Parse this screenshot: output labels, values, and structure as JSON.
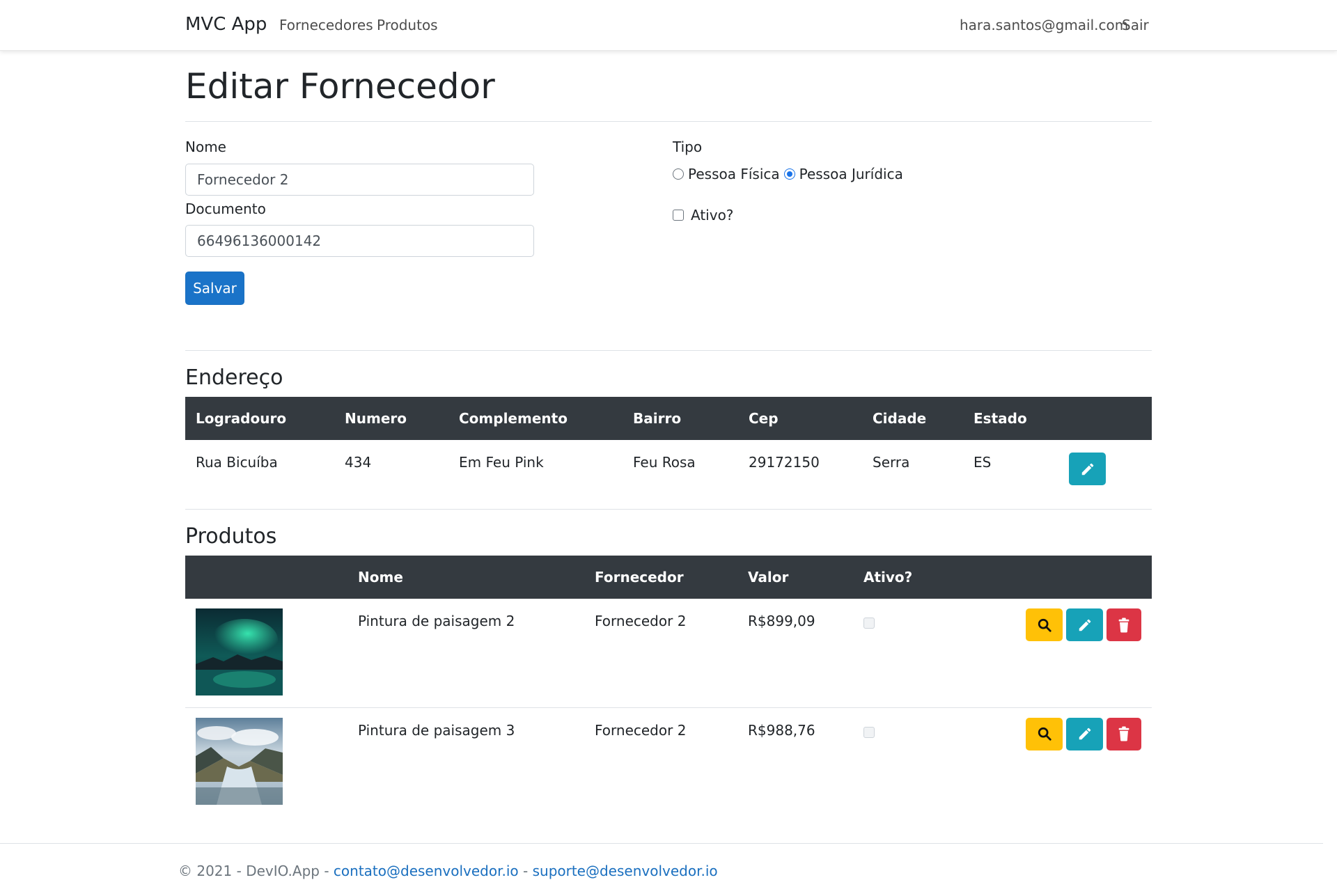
{
  "nav": {
    "brand": "MVC App",
    "links": [
      "Fornecedores",
      "Produtos"
    ],
    "user_email": "hara.santos@gmail.com",
    "logout": "Sair"
  },
  "page": {
    "title": "Editar Fornecedor"
  },
  "form": {
    "nome_label": "Nome",
    "nome_value": "Fornecedor 2",
    "documento_label": "Documento",
    "documento_value": "66496136000142",
    "tipo_label": "Tipo",
    "tipo_options": [
      "Pessoa Física",
      "Pessoa Jurídica"
    ],
    "tipo_selected": "Pessoa Jurídica",
    "ativo_label": "Ativo?",
    "ativo_checked": false,
    "save_label": "Salvar"
  },
  "endereco": {
    "title": "Endereço",
    "headers": [
      "Logradouro",
      "Numero",
      "Complemento",
      "Bairro",
      "Cep",
      "Cidade",
      "Estado"
    ],
    "row": [
      "Rua Bicuíba",
      "434",
      "Em Feu Pink",
      "Feu Rosa",
      "29172150",
      "Serra",
      "ES"
    ]
  },
  "produtos": {
    "title": "Produtos",
    "headers": [
      "",
      "Nome",
      "Fornecedor",
      "Valor",
      "Ativo?"
    ],
    "rows": [
      {
        "nome": "Pintura de paisagem 2",
        "fornecedor": "Fornecedor 2",
        "valor": "R$899,09",
        "ativo": false
      },
      {
        "nome": "Pintura de paisagem 3",
        "fornecedor": "Fornecedor 2",
        "valor": "R$988,76",
        "ativo": false
      }
    ]
  },
  "footer": {
    "prefix": "© 2021 - DevIO.App -",
    "contact": "contato@desenvolvedor.io",
    "separator": "-",
    "support": "suporte@desenvolvedor.io"
  },
  "colors": {
    "primary": "#1a73c8",
    "info": "#17a2b8",
    "warning": "#ffc107",
    "danger": "#dc3545",
    "table_header": "#343a40"
  },
  "icons": {
    "search": "search-icon",
    "edit": "pencil-icon",
    "delete": "trash-icon"
  }
}
